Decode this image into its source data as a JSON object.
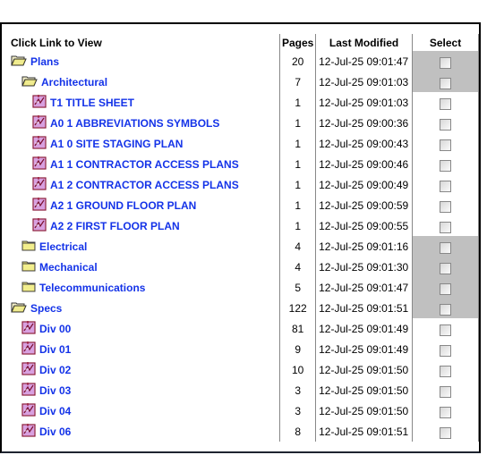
{
  "header": {
    "name_col": "Click Link to View",
    "pages_col": "Pages",
    "modified_col": "Last Modified",
    "select_col": "Select"
  },
  "colors": {
    "link": "#1433e8",
    "folder_select_bg": "#c0c0c0"
  },
  "rows": [
    {
      "label": "Plans",
      "type": "folder-open",
      "level": 0,
      "pages": "20",
      "modified": "12-Jul-25 09:01:47",
      "checked": false,
      "highlight": true
    },
    {
      "label": "Architectural",
      "type": "folder-open",
      "level": 1,
      "pages": "7",
      "modified": "12-Jul-25 09:01:03",
      "checked": false,
      "highlight": true
    },
    {
      "label": "T1 TITLE SHEET",
      "type": "pdf",
      "level": 2,
      "pages": "1",
      "modified": "12-Jul-25 09:01:03",
      "checked": false,
      "highlight": false
    },
    {
      "label": "A0 1 ABBREVIATIONS SYMBOLS",
      "type": "pdf",
      "level": 2,
      "pages": "1",
      "modified": "12-Jul-25 09:00:36",
      "checked": false,
      "highlight": false
    },
    {
      "label": "A1 0 SITE STAGING PLAN",
      "type": "pdf",
      "level": 2,
      "pages": "1",
      "modified": "12-Jul-25 09:00:43",
      "checked": false,
      "highlight": false
    },
    {
      "label": "A1 1 CONTRACTOR ACCESS PLANS",
      "type": "pdf",
      "level": 2,
      "pages": "1",
      "modified": "12-Jul-25 09:00:46",
      "checked": false,
      "highlight": false
    },
    {
      "label": "A1 2 CONTRACTOR ACCESS PLANS",
      "type": "pdf",
      "level": 2,
      "pages": "1",
      "modified": "12-Jul-25 09:00:49",
      "checked": false,
      "highlight": false
    },
    {
      "label": "A2 1 GROUND FLOOR PLAN",
      "type": "pdf",
      "level": 2,
      "pages": "1",
      "modified": "12-Jul-25 09:00:59",
      "checked": false,
      "highlight": false
    },
    {
      "label": "A2 2 FIRST FLOOR PLAN",
      "type": "pdf",
      "level": 2,
      "pages": "1",
      "modified": "12-Jul-25 09:00:55",
      "checked": false,
      "highlight": false
    },
    {
      "label": "Electrical",
      "type": "folder-closed",
      "level": 1,
      "pages": "4",
      "modified": "12-Jul-25 09:01:16",
      "checked": false,
      "highlight": true
    },
    {
      "label": "Mechanical",
      "type": "folder-closed",
      "level": 1,
      "pages": "4",
      "modified": "12-Jul-25 09:01:30",
      "checked": false,
      "highlight": true
    },
    {
      "label": "Telecommunications",
      "type": "folder-closed",
      "level": 1,
      "pages": "5",
      "modified": "12-Jul-25 09:01:47",
      "checked": false,
      "highlight": true
    },
    {
      "label": "Specs",
      "type": "folder-open",
      "level": 0,
      "pages": "122",
      "modified": "12-Jul-25 09:01:51",
      "checked": false,
      "highlight": true
    },
    {
      "label": "Div 00",
      "type": "pdf",
      "level": 1,
      "pages": "81",
      "modified": "12-Jul-25 09:01:49",
      "checked": false,
      "highlight": false
    },
    {
      "label": "Div 01",
      "type": "pdf",
      "level": 1,
      "pages": "9",
      "modified": "12-Jul-25 09:01:49",
      "checked": false,
      "highlight": false
    },
    {
      "label": "Div 02",
      "type": "pdf",
      "level": 1,
      "pages": "10",
      "modified": "12-Jul-25 09:01:50",
      "checked": false,
      "highlight": false
    },
    {
      "label": "Div 03",
      "type": "pdf",
      "level": 1,
      "pages": "3",
      "modified": "12-Jul-25 09:01:50",
      "checked": false,
      "highlight": false
    },
    {
      "label": "Div 04",
      "type": "pdf",
      "level": 1,
      "pages": "3",
      "modified": "12-Jul-25 09:01:50",
      "checked": false,
      "highlight": false
    },
    {
      "label": "Div 06",
      "type": "pdf",
      "level": 1,
      "pages": "8",
      "modified": "12-Jul-25 09:01:51",
      "checked": false,
      "highlight": false
    }
  ]
}
